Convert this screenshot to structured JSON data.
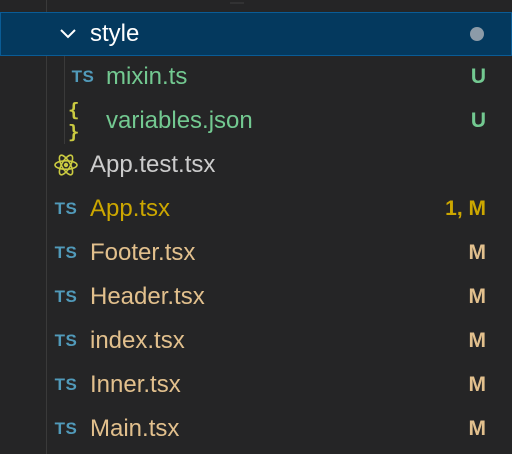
{
  "colors": {
    "background": "#252526",
    "selected_background": "#04395e",
    "folder_text": "#ffffff",
    "untracked": "#73c991",
    "modified": "#e2c08d",
    "error_modified": "#cca700",
    "neutral_text": "#cccccc",
    "ts_icon": "#519aba",
    "json_icon": "#cbcb41",
    "react_icon": "#cbcb41"
  },
  "tree": {
    "folder": {
      "name": "style",
      "icon": "chevron-down-icon",
      "status": "dot"
    },
    "children": [
      {
        "name": "mixin.ts",
        "icon_text": "TS",
        "icon": "typescript-icon",
        "status": "U"
      },
      {
        "name": "variables.json",
        "icon_text": "{ }",
        "icon": "json-braces-icon",
        "status": "U"
      }
    ],
    "files": [
      {
        "name": "App.test.tsx",
        "icon": "react-atom-icon",
        "status": ""
      },
      {
        "name": "App.tsx",
        "icon_text": "TS",
        "icon": "typescript-icon",
        "status": "1, M"
      },
      {
        "name": "Footer.tsx",
        "icon_text": "TS",
        "icon": "typescript-icon",
        "status": "M"
      },
      {
        "name": "Header.tsx",
        "icon_text": "TS",
        "icon": "typescript-icon",
        "status": "M"
      },
      {
        "name": "index.tsx",
        "icon_text": "TS",
        "icon": "typescript-icon",
        "status": "M"
      },
      {
        "name": "Inner.tsx",
        "icon_text": "TS",
        "icon": "typescript-icon",
        "status": "M"
      },
      {
        "name": "Main.tsx",
        "icon_text": "TS",
        "icon": "typescript-icon",
        "status": "M"
      }
    ]
  }
}
